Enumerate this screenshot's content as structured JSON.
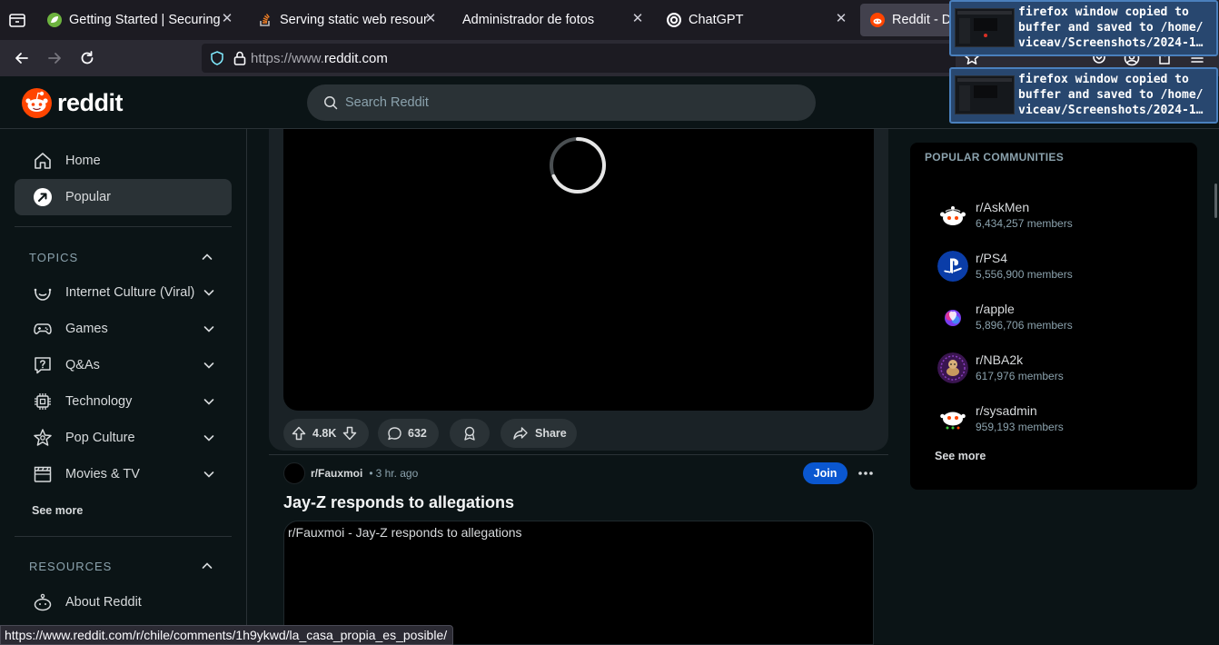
{
  "browser": {
    "tabs": [
      {
        "title": "Getting Started | Securing",
        "icon": "spring-leaf-icon"
      },
      {
        "title": "Serving static web resour",
        "icon": "stackoverflow-icon"
      },
      {
        "title": "Administrador de fotos",
        "icon": ""
      },
      {
        "title": "ChatGPT",
        "icon": "openai-icon"
      },
      {
        "title": "Reddit - D",
        "icon": "reddit-icon"
      }
    ],
    "url_prefix": "https://www.",
    "url_domain": "reddit.com",
    "status_link": "https://www.reddit.com/r/chile/comments/1h9ykwd/la_casa_propia_es_posible/"
  },
  "notifications": [
    {
      "text": "firefox window copied to\nbuffer and saved to /home/\nviceav/Screenshots/2024-1…"
    },
    {
      "text": "firefox window copied to\nbuffer and saved to /home/\nviceav/Screenshots/2024-1…"
    }
  ],
  "header": {
    "logo_text": "reddit",
    "search_placeholder": "Search Reddit"
  },
  "sidebar": {
    "main": [
      {
        "label": "Home",
        "icon": "home-icon"
      },
      {
        "label": "Popular",
        "icon": "popular-icon"
      }
    ],
    "topics_title": "TOPICS",
    "topics": [
      {
        "label": "Internet Culture (Viral)",
        "icon": "smile-icon"
      },
      {
        "label": "Games",
        "icon": "gamepad-icon"
      },
      {
        "label": "Q&As",
        "icon": "question-icon"
      },
      {
        "label": "Technology",
        "icon": "chip-icon"
      },
      {
        "label": "Pop Culture",
        "icon": "star-icon"
      },
      {
        "label": "Movies & TV",
        "icon": "clapper-icon"
      }
    ],
    "see_more": "See more",
    "resources_title": "RESOURCES",
    "resources": [
      {
        "label": "About Reddit",
        "icon": "about-icon"
      }
    ]
  },
  "feed": {
    "post1": {
      "votes": "4.8K",
      "comments": "632",
      "share": "Share"
    },
    "post2": {
      "subreddit": "r/Fauxmoi",
      "time": "3 hr. ago",
      "join": "Join",
      "title": "Jay-Z responds to allegations",
      "media_alt": "r/Fauxmoi - Jay-Z responds to allegations"
    }
  },
  "popular_communities": {
    "title": "POPULAR COMMUNITIES",
    "items": [
      {
        "name": "r/AskMen",
        "members": "6,434,257 members",
        "icon": "askmen-avatar"
      },
      {
        "name": "r/PS4",
        "members": "5,556,900 members",
        "icon": "playstation-avatar"
      },
      {
        "name": "r/apple",
        "members": "5,896,706 members",
        "icon": "apple-avatar"
      },
      {
        "name": "r/NBA2k",
        "members": "617,976 members",
        "icon": "nba2k-avatar"
      },
      {
        "name": "r/sysadmin",
        "members": "959,193 members",
        "icon": "sysadmin-avatar"
      }
    ],
    "see_more": "See more"
  },
  "colors": {
    "reddit_orange": "#ff4500",
    "join_blue": "#0a57d0",
    "background": "#0b1416"
  }
}
